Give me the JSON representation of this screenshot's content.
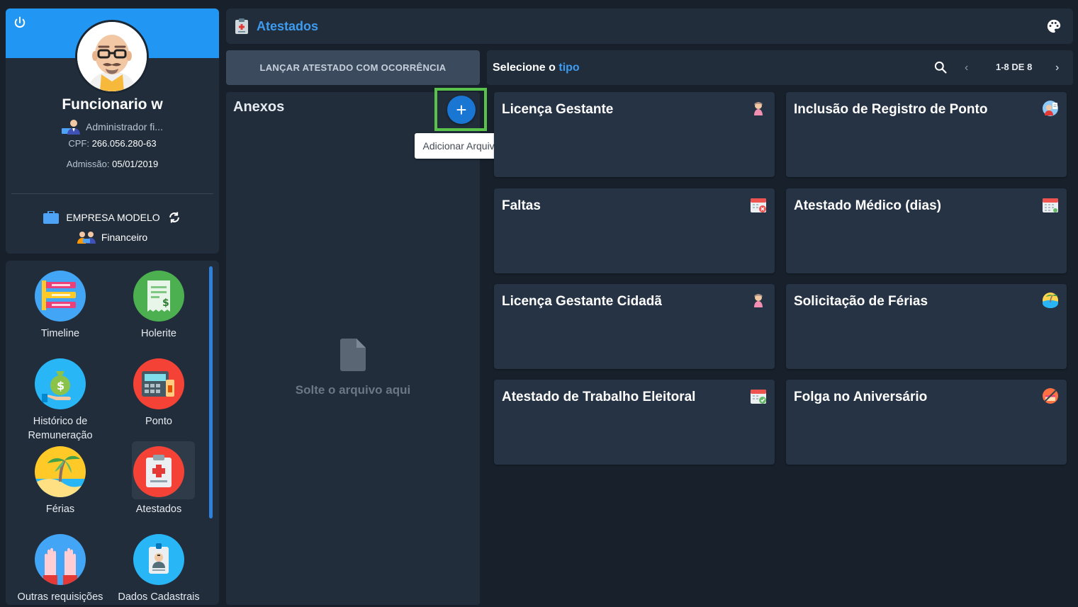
{
  "profile": {
    "name": "Funcionario w",
    "role": "Administrador fi...",
    "cpf_label": "CPF:",
    "cpf": "266.056.280-63",
    "admission_label": "Admissão:",
    "admission": "05/01/2019",
    "company": "EMPRESA MODELO",
    "department": "Financeiro"
  },
  "menu": {
    "items": [
      {
        "label": "Timeline",
        "icon": "timeline-icon",
        "color": "#42a5f5"
      },
      {
        "label": "Holerite",
        "icon": "payslip-icon",
        "color": "#4caf50"
      },
      {
        "label": "Histórico de Remuneração",
        "icon": "money-bag-icon",
        "color": "#29b6f6"
      },
      {
        "label": "Ponto",
        "icon": "time-clock-icon",
        "color": "#f44336"
      },
      {
        "label": "Férias",
        "icon": "beach-icon",
        "color": "#ffca28"
      },
      {
        "label": "Atestados",
        "icon": "clipboard-icon",
        "color": "#f44336"
      },
      {
        "label": "Outras requisições",
        "icon": "raised-hands-icon",
        "color": "#42a5f5"
      },
      {
        "label": "Dados Cadastrais",
        "icon": "id-badge-icon",
        "color": "#29b6f6"
      }
    ]
  },
  "topbar": {
    "title": "Atestados"
  },
  "launch_button": {
    "label": "LANÇAR ATESTADO COM OCORRÊNCIA"
  },
  "attachments": {
    "title": "Anexos",
    "drop_text": "Solte o arquivo aqui",
    "add_tooltip": "Adicionar Arquivo",
    "add_symbol": "+"
  },
  "selector": {
    "title_prefix": "Selecione o",
    "title_highlight": "tipo",
    "pagination": "1-8 DE 8",
    "prev_symbol": "‹",
    "next_symbol": "›"
  },
  "types": [
    {
      "label": "Licença Gestante",
      "icon": "pregnant-woman-icon"
    },
    {
      "label": "Inclusão de Registro de Ponto",
      "icon": "clock-register-icon"
    },
    {
      "label": "Faltas",
      "icon": "calendar-absence-icon"
    },
    {
      "label": "Atestado Médico (dias)",
      "icon": "calendar-medical-icon"
    },
    {
      "label": "Licença Gestante Cidadã",
      "icon": "pregnant-woman-icon"
    },
    {
      "label": "Solicitação de Férias",
      "icon": "beach-ball-icon"
    },
    {
      "label": "Atestado de Trabalho Eleitoral",
      "icon": "calendar-vote-icon"
    },
    {
      "label": "Folga no Aniversário",
      "icon": "birthday-icon"
    }
  ],
  "colors": {
    "accent": "#2196f3",
    "highlight_box": "#58c24a",
    "background": "#17202b",
    "panel": "#212d3b",
    "card": "#253344"
  }
}
